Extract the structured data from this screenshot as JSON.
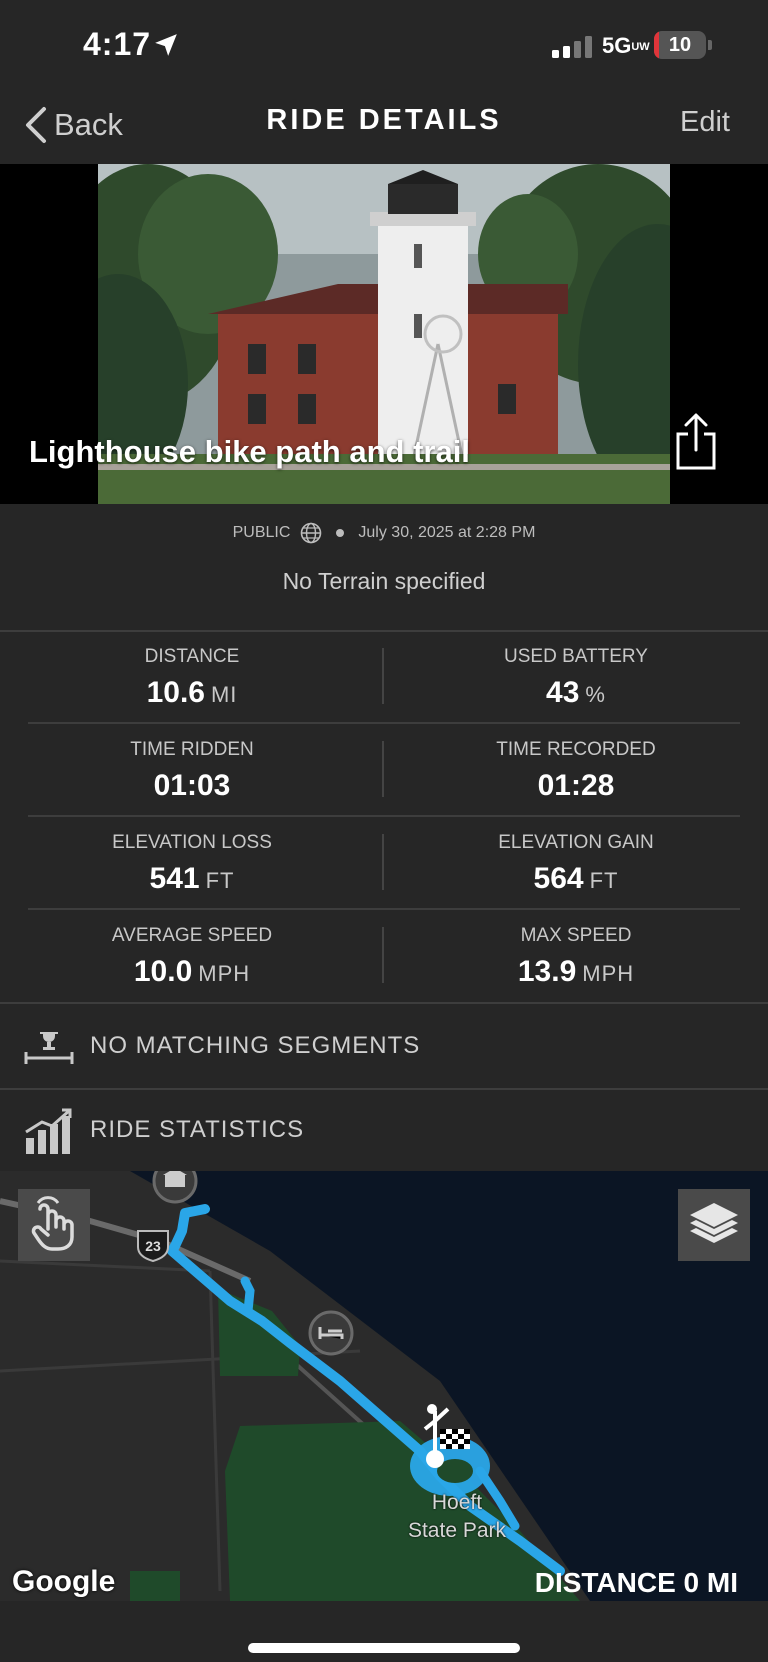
{
  "status_bar": {
    "time": "4:17",
    "network": "5G",
    "network_sup": "UW",
    "battery_text": "10",
    "battery_level": 0.1,
    "location_icon": "location-arrow-icon",
    "signal_icon": "signal-bars-icon"
  },
  "nav": {
    "back_label": "Back",
    "title": "RIDE DETAILS",
    "edit_label": "Edit"
  },
  "ride": {
    "name": "Lighthouse bike path and trail",
    "visibility": "PUBLIC",
    "date": "July 30, 2025 at 2:28 PM",
    "terrain": "No Terrain specified",
    "share_icon": "share-icon",
    "globe_icon": "globe-icon"
  },
  "stats": {
    "distance": {
      "label": "DISTANCE",
      "value": "10.6",
      "unit": "MI"
    },
    "used_battery": {
      "label": "USED BATTERY",
      "value": "43",
      "unit": "%"
    },
    "time_ridden": {
      "label": "TIME RIDDEN",
      "value": "01:03",
      "unit": ""
    },
    "time_recorded": {
      "label": "TIME RECORDED",
      "value": "01:28",
      "unit": ""
    },
    "elevation_loss": {
      "label": "ELEVATION LOSS",
      "value": "541",
      "unit": "FT"
    },
    "elevation_gain": {
      "label": "ELEVATION GAIN",
      "value": "564",
      "unit": "FT"
    },
    "average_speed": {
      "label": "AVERAGE SPEED",
      "value": "10.0",
      "unit": "MPH"
    },
    "max_speed": {
      "label": "MAX SPEED",
      "value": "13.9",
      "unit": "MPH"
    }
  },
  "sections": {
    "segments_label": "NO MATCHING SEGMENTS",
    "segments_icon": "trophy-podium-icon",
    "ride_statistics_label": "RIDE STATISTICS",
    "ride_statistics_icon": "bar-chart-icon"
  },
  "map": {
    "highway_shield": "23",
    "park_label_line1": "Hoeft",
    "park_label_line2": "State Park",
    "google_logo": "Google",
    "distance_label": "DISTANCE 0 MI",
    "gesture_icon": "hand-pointer-icon",
    "layers_icon": "layers-icon",
    "route_color": "#2aa6e8",
    "water_color": "#0b1524",
    "land_color": "#2b2b2b",
    "park_color": "#1f4a2a"
  }
}
